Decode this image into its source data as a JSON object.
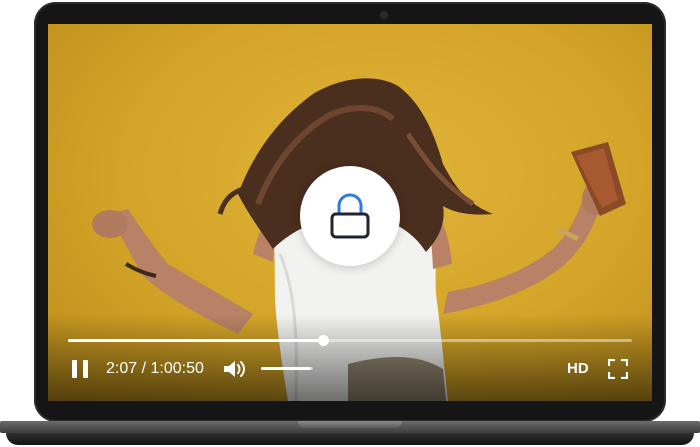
{
  "player": {
    "current_time": "2:07",
    "separator": " / ",
    "duration": "1:00:50",
    "progress_fraction": 0.452,
    "volume_fraction": 0.96,
    "quality_label": "HD"
  },
  "colors": {
    "background_wall": "#d6a92a",
    "lock_accent": "#2d7be0",
    "lock_body": "#1f2430",
    "controls": "#ffffff"
  },
  "icons": {
    "pause": "pause-icon",
    "volume": "volume-icon",
    "fullscreen": "fullscreen-icon",
    "lock": "lock-icon"
  }
}
